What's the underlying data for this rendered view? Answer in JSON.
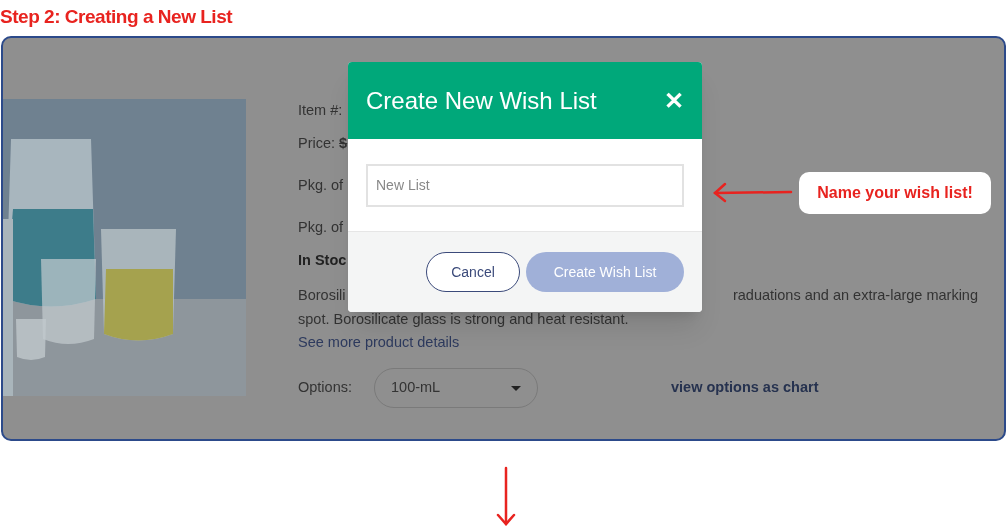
{
  "heading": "Step 2: Creating a New List",
  "product": {
    "item_label": "Item #:",
    "price_label": "Price:",
    "price_value": "$",
    "pkg_1": "Pkg. of",
    "pkg_2": "Pkg. of",
    "stock": "In Stoc",
    "description_start": "Borosili",
    "description_end": "raduations and an extra-large marking",
    "description_line_2": "spot. Borosilicate glass is strong and heat resistant.",
    "details_link": "See more product details",
    "options_label": "Options:",
    "options_value": "100-mL",
    "chart_link": "view options as chart"
  },
  "dialog": {
    "title": "Create New Wish List",
    "close": "✕",
    "field": {
      "placeholder": "New List"
    },
    "buttons": [
      {
        "label": "Cancel",
        "kind": "secondary",
        "disabled": false
      },
      {
        "label": "Create Wish List",
        "kind": "primary",
        "disabled": true
      }
    ]
  },
  "callout": "Name your wish list!"
}
